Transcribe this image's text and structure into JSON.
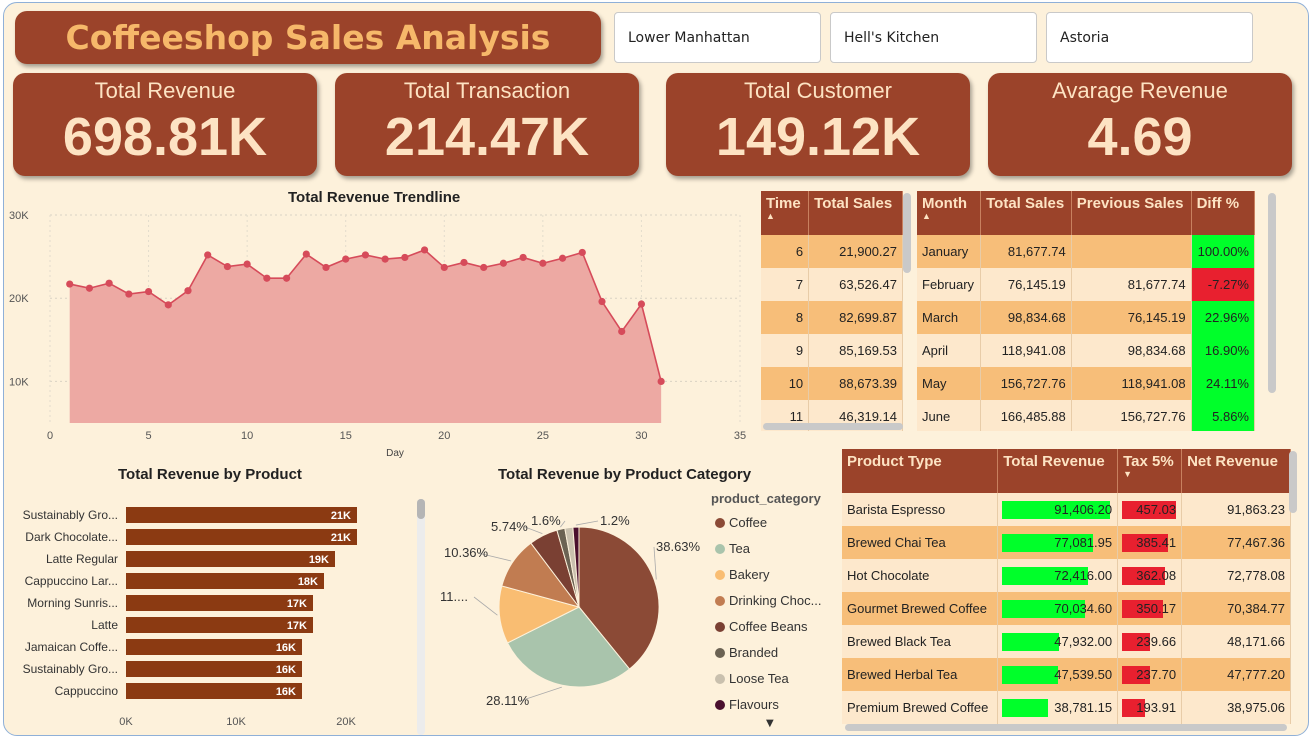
{
  "title": "Coffeeshop Sales Analysis",
  "slicers": [
    "Lower Manhattan",
    "Hell's Kitchen",
    "Astoria"
  ],
  "kpis": [
    {
      "label": "Total Revenue",
      "value": "698.81K"
    },
    {
      "label": "Total Transaction",
      "value": "214.47K"
    },
    {
      "label": "Total Customer",
      "value": "149.12K"
    },
    {
      "label": "Avarage Revenue",
      "value": "4.69"
    }
  ],
  "trend": {
    "title": "Total Revenue Trendline",
    "xlabel": "Day",
    "x_ticks": [
      "0",
      "5",
      "10",
      "15",
      "20",
      "25",
      "30",
      "35"
    ],
    "y_ticks": [
      "10K",
      "20K",
      "30K"
    ],
    "xlim": [
      0,
      35
    ],
    "ylim": [
      5000,
      30000
    ],
    "color_fill": "#eda9a3",
    "color_line": "#d64b5a"
  },
  "chart_data": [
    {
      "type": "area",
      "title": "Total Revenue Trendline",
      "xlabel": "Day",
      "ylabel": "",
      "x": [
        1,
        2,
        3,
        4,
        5,
        6,
        7,
        8,
        9,
        10,
        11,
        12,
        13,
        14,
        15,
        16,
        17,
        18,
        19,
        20,
        21,
        22,
        23,
        24,
        25,
        26,
        27,
        28,
        29,
        30,
        31
      ],
      "values": [
        21700,
        21200,
        21800,
        20500,
        20800,
        19200,
        20900,
        25200,
        23800,
        24100,
        22400,
        22400,
        25300,
        23700,
        24700,
        25200,
        24700,
        24900,
        25800,
        23700,
        24300,
        23700,
        24200,
        24900,
        24200,
        24800,
        25500,
        19600,
        16000,
        19300,
        10000
      ],
      "xlim": [
        0,
        35
      ],
      "ylim": [
        5000,
        30000
      ],
      "grid": true
    },
    {
      "type": "bar",
      "title": "Total Revenue by Product",
      "categories": [
        "Sustainably Gro...",
        "Dark Chocolate...",
        "Latte Regular",
        "Cappuccino Lar...",
        "Morning Sunris...",
        "Latte",
        "Jamaican Coffe...",
        "Sustainably Gro...",
        "Cappuccino"
      ],
      "values": [
        21000,
        21000,
        19000,
        18000,
        17000,
        17000,
        16000,
        16000,
        16000
      ],
      "value_labels": [
        "21K",
        "21K",
        "19K",
        "18K",
        "17K",
        "17K",
        "16K",
        "16K",
        "16K"
      ],
      "x_ticks": [
        "0K",
        "10K",
        "20K"
      ],
      "xlim": [
        0,
        22000
      ]
    },
    {
      "type": "pie",
      "title": "Total Revenue by Product Category",
      "legend_title": "product_category",
      "categories": [
        "Coffee",
        "Tea",
        "Bakery",
        "Drinking Choc...",
        "Coffee Beans",
        "Branded",
        "Loose Tea",
        "Flavours"
      ],
      "values": [
        38.63,
        28.11,
        11.5,
        10.36,
        5.74,
        1.6,
        1.6,
        1.2
      ],
      "labels": [
        "38.63%",
        "28.11%",
        "11....",
        "10.36%",
        "5.74%",
        "1.6%",
        "",
        "1.2%"
      ],
      "colors": [
        "#8b4a36",
        "#a9c4ac",
        "#f9bd72",
        "#c17c51",
        "#7a4033",
        "#6b6253",
        "#c9c0ae",
        "#4a0f2e"
      ]
    }
  ],
  "time_table": {
    "headers": [
      "Time",
      "Total Sales"
    ],
    "rows": [
      [
        "6",
        "21,900.27"
      ],
      [
        "7",
        "63,526.47"
      ],
      [
        "8",
        "82,699.87"
      ],
      [
        "9",
        "85,169.53"
      ],
      [
        "10",
        "88,673.39"
      ],
      [
        "11",
        "46,319.14"
      ]
    ]
  },
  "month_table": {
    "headers": [
      "Month",
      "Total Sales",
      "Previous Sales",
      "Diff %"
    ],
    "rows": [
      [
        "January",
        "81,677.74",
        "",
        "100.00%"
      ],
      [
        "February",
        "76,145.19",
        "81,677.74",
        "-7.27%"
      ],
      [
        "March",
        "98,834.68",
        "76,145.19",
        "22.96%"
      ],
      [
        "April",
        "118,941.08",
        "98,834.68",
        "16.90%"
      ],
      [
        "May",
        "156,727.76",
        "118,941.08",
        "24.11%"
      ],
      [
        "June",
        "166,485.88",
        "156,727.76",
        "5.86%"
      ]
    ]
  },
  "product_table": {
    "headers": [
      "Product Type",
      "Total Revenue",
      "Tax 5%",
      "Net Revenue"
    ],
    "rows": [
      {
        "name": "Barista Espresso",
        "rev": "91,406.20",
        "rev_v": 91406.2,
        "tax": "457.03",
        "tax_v": 457.03,
        "net": "91,863.23"
      },
      {
        "name": "Brewed Chai Tea",
        "rev": "77,081.95",
        "rev_v": 77081.95,
        "tax": "385.41",
        "tax_v": 385.41,
        "net": "77,467.36"
      },
      {
        "name": "Hot Chocolate",
        "rev": "72,416.00",
        "rev_v": 72416.0,
        "tax": "362.08",
        "tax_v": 362.08,
        "net": "72,778.08"
      },
      {
        "name": "Gourmet Brewed Coffee",
        "rev": "70,034.60",
        "rev_v": 70034.6,
        "tax": "350.17",
        "tax_v": 350.17,
        "net": "70,384.77"
      },
      {
        "name": "Brewed Black Tea",
        "rev": "47,932.00",
        "rev_v": 47932.0,
        "tax": "239.66",
        "tax_v": 239.66,
        "net": "48,171.66"
      },
      {
        "name": "Brewed Herbal Tea",
        "rev": "47,539.50",
        "rev_v": 47539.5,
        "tax": "237.70",
        "tax_v": 237.7,
        "net": "47,777.20"
      },
      {
        "name": "Premium Brewed Coffee",
        "rev": "38,781.15",
        "rev_v": 38781.15,
        "tax": "193.91",
        "tax_v": 193.91,
        "net": "38,975.06"
      }
    ],
    "rev_bar_color": "#00ff2a",
    "tax_bar_color": "#e8202f"
  },
  "colors": {
    "brand": "#9b432a",
    "accent_text": "#f6b86a",
    "background": "#fdf1db",
    "row_odd": "#f7be79",
    "row_even": "#fde8cc",
    "product_bar": "#8b3a12"
  }
}
